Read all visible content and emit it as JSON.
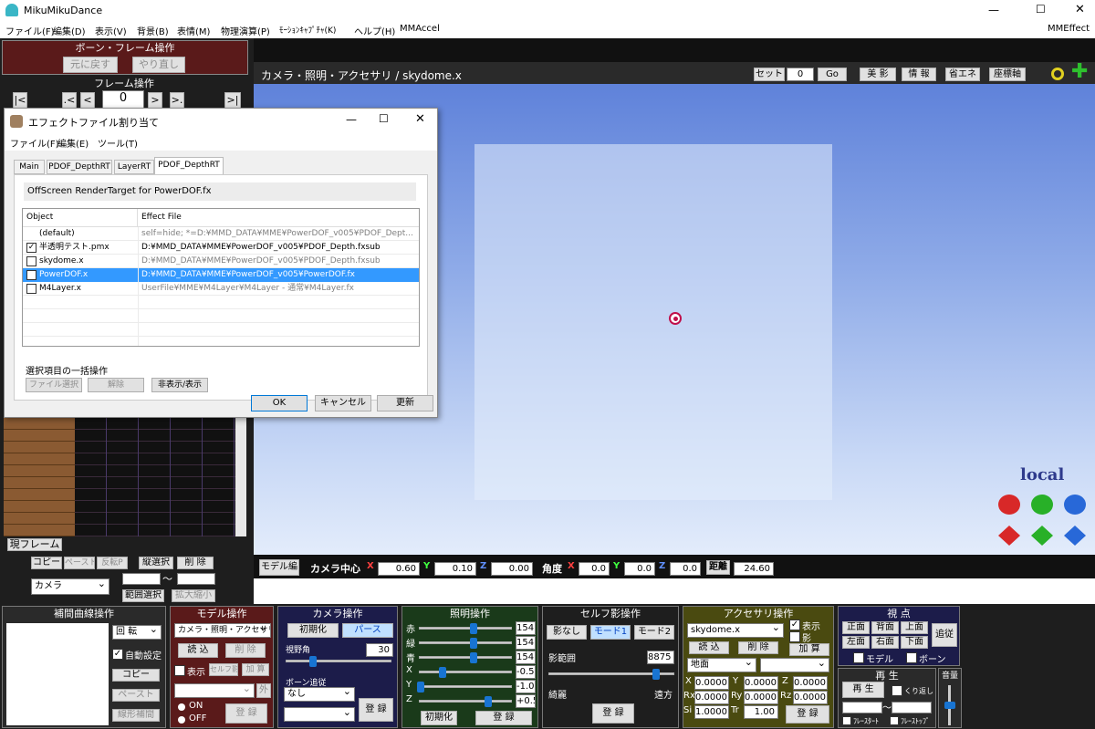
{
  "window": {
    "title": "MikuMikuDance",
    "min": "—",
    "max": "☐",
    "close": "✕"
  },
  "menu": [
    "ファイル(F)",
    "編集(D)",
    "表示(V)",
    "背景(B)",
    "表情(M)",
    "物理演算(P)",
    "ﾓｰｼｮﾝｷｬﾌﾟﾁｬ(K)",
    "ヘルプ(H)",
    "MMAccel"
  ],
  "menu_right": "MMEffect",
  "bone_ops": {
    "title": "ボーン・フレーム操作",
    "undo": "元に戻す",
    "redo": "やり直し"
  },
  "frame_ops": {
    "title": "フレーム操作",
    "first": "|<",
    "prev": ".<",
    "frame": "0",
    "next": ">",
    "next2": ">.",
    "last": ">|"
  },
  "viewport": {
    "title": "カメラ・照明・アクセサリ / skydome.x",
    "set_label": "セット",
    "set_value": "0",
    "go": "Go",
    "buttons": [
      "美 影",
      "情 報",
      "省エネ",
      "座標軸"
    ],
    "local": "local"
  },
  "effect_dialog": {
    "title": "エフェクトファイル割り当て",
    "menu": [
      "ファイル(F)",
      "編集(E)",
      "ツール(T)"
    ],
    "tabs": [
      "Main",
      "PDOF_DepthRT",
      "LayerRT",
      "PDOF_DepthRT"
    ],
    "description": "OffScreen RenderTarget for PowerDOF.fx",
    "columns": [
      "Object",
      "Effect File"
    ],
    "rows": [
      {
        "object": "(default)",
        "effect": "self=hide; *=D:¥MMD_DATA¥MME¥PowerDOF_v005¥PDOF_Dept...",
        "check": "",
        "gray": true
      },
      {
        "object": "半透明テスト.pmx",
        "effect": "D:¥MMD_DATA¥MME¥PowerDOF_v005¥PDOF_Depth.fxsub",
        "check": "✓",
        "gray": false
      },
      {
        "object": "skydome.x",
        "effect": "D:¥MMD_DATA¥MME¥PowerDOF_v005¥PDOF_Depth.fxsub",
        "check": "",
        "gray": true
      },
      {
        "object": "PowerDOF.x",
        "effect": "D:¥MMD_DATA¥MME¥PowerDOF_v005¥PowerDOF.fx",
        "check": "",
        "gray": false,
        "selected": true
      },
      {
        "object": "M4Layer.x",
        "effect": "UserFile¥MME¥M4Layer¥M4Layer - 通常¥M4Layer.fx",
        "check": "",
        "gray": true
      }
    ],
    "bulk_label": "選択項目の一括操作",
    "bulk_buttons": [
      "ファイル選択",
      "解除",
      "非表示/表示"
    ],
    "ok": "OK",
    "cancel": "キャンセル",
    "update": "更新"
  },
  "timeline": {
    "current_frame": "現フレーム",
    "copy": "コピー",
    "paste": "ペースト",
    "invert": "反転P",
    "vsel": "縦選択",
    "delete": "削 除",
    "camera_select": "カメラ",
    "tilde": "～",
    "range_select": "範囲選択",
    "scale": "拡大縮小"
  },
  "status_bar": {
    "model_edit": "モデル編",
    "camera_center": "カメラ中心",
    "x": "X",
    "y": "Y",
    "z": "Z",
    "cx": "0.60",
    "cy": "0.10",
    "cz": "0.00",
    "angle": "角度",
    "ax": "0.0",
    "ay": "0.0",
    "az": "0.0",
    "distance": "距離",
    "dist_value": "24.60"
  },
  "interp_panel": {
    "title": "補間曲線操作",
    "rotate": "回 転",
    "auto": "自動設定",
    "copy": "コピー",
    "paste": "ペースト",
    "linear": "線形補間"
  },
  "model_panel": {
    "title": "モデル操作",
    "select": "カメラ・照明・アクセサリ",
    "load": "読 込",
    "delete": "削 除",
    "show": "表示",
    "self_shadow": "セルフ影",
    "add": "加 算",
    "outer": "外",
    "on": "ON",
    "off": "OFF",
    "register": "登 録"
  },
  "camera_panel": {
    "title": "カメラ操作",
    "init": "初期化",
    "perspective": "パース",
    "fov_label": "視野角",
    "fov": "30",
    "bone_follow": "ボーン追従",
    "none": "なし",
    "register": "登 録"
  },
  "light_panel": {
    "title": "照明操作",
    "labels": [
      "赤",
      "緑",
      "青",
      "X",
      "Y",
      "Z"
    ],
    "values": [
      "154",
      "154",
      "154",
      "-0.5",
      "-1.0",
      "+0.5"
    ],
    "init": "初期化",
    "register": "登 録"
  },
  "self_shadow_panel": {
    "title": "セルフ影操作",
    "no_shadow": "影なし",
    "mode1": "モード1",
    "mode2": "モード2",
    "range_label": "影範囲",
    "range": "8875",
    "near": "綺麗",
    "far": "遠方",
    "register": "登 録"
  },
  "accessory_panel": {
    "title": "アクセサリ操作",
    "select": "skydome.x",
    "show": "表示",
    "shadow": "影",
    "load": "読 込",
    "delete": "削 除",
    "add": "加 算",
    "ground": "地面",
    "x": "0.0000",
    "y": "0.0000",
    "z": "0.0000",
    "rx": "0.0000",
    "ry": "0.0000",
    "rz": "0.0000",
    "si": "1.0000",
    "tr": "1.00",
    "register": "登 録",
    "lbl_x": "X",
    "lbl_y": "Y",
    "lbl_z": "Z",
    "lbl_rx": "Rx",
    "lbl_ry": "Ry",
    "lbl_rz": "Rz",
    "lbl_si": "Si",
    "lbl_tr": "Tr"
  },
  "view_panel": {
    "title": "視 点",
    "front": "正面",
    "back": "背面",
    "top": "上面",
    "left": "左面",
    "right": "右面",
    "bottom": "下面",
    "follow": "追従",
    "model": "モデル",
    "bone": "ボーン"
  },
  "play_panel": {
    "title": "再 生",
    "play": "再 生",
    "repeat": "くり返し",
    "tilde": "～",
    "frame_start": "ﾌﾚｰｽﾀｰﾄ",
    "frame_stop": "ﾌﾚｰｽﾄｯﾌﾟ"
  },
  "volume_panel": {
    "title": "音量"
  },
  "colors": {
    "panel_dark_red": "#5a1a1a",
    "viewport_dark": "#1c1c1c",
    "accent_blue": "#3399ff",
    "sky_top": "#6e8fde",
    "sky_bottom": "#dfe9fb"
  }
}
